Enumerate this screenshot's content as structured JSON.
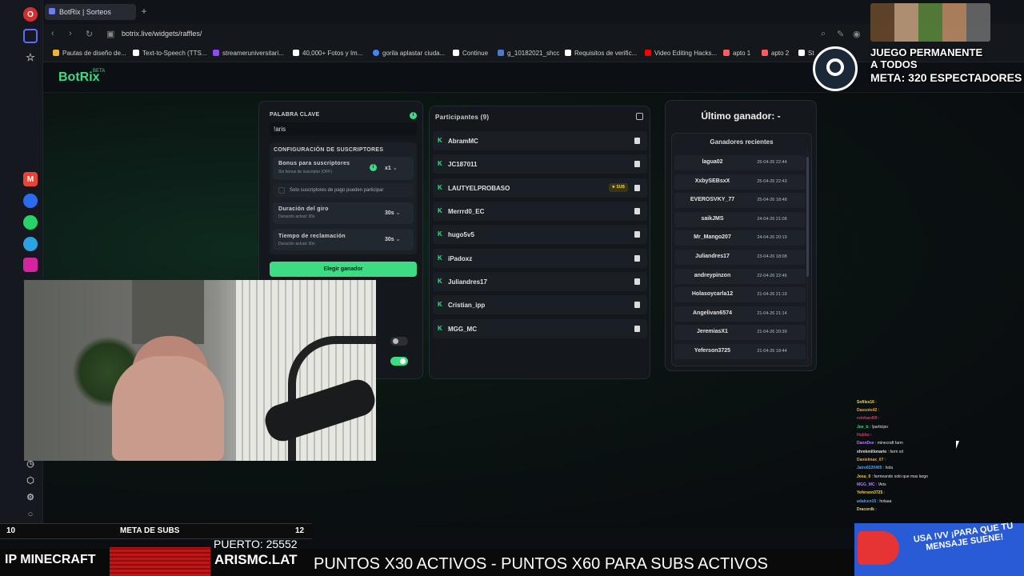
{
  "browser": {
    "tab_title": "BotRix | Sorteos",
    "new_tab": "+",
    "url": "botrix.live/widgets/raffles/",
    "bookmarks": [
      {
        "label": "Pautas de diseño de...",
        "color": "#f2b233"
      },
      {
        "label": "Text-to-Speech (TTS...",
        "color": "#ffffff"
      },
      {
        "label": "streameruniversitari...",
        "color": "#9146ff"
      },
      {
        "label": "40,000+ Fotos y Im...",
        "color": "#ffffff"
      },
      {
        "label": "gorila aplastar ciuda...",
        "color": "#4285f4"
      },
      {
        "label": "Continue",
        "color": "#ffffff"
      },
      {
        "label": "g_10182021_shcc",
        "color": "#4a7bd0"
      },
      {
        "label": "Requisitos de verific...",
        "color": "#ffffff"
      },
      {
        "label": "Video Editing Hacks...",
        "color": "#ff0000"
      },
      {
        "label": "apto 1",
        "color": "#ff5a5f"
      },
      {
        "label": "apto 2",
        "color": "#ff5a5f"
      },
      {
        "label": "St",
        "color": "#ffffff"
      }
    ],
    "rail_icons": [
      "opera-logo-icon",
      "home-icon",
      "star-icon",
      "gmail-icon",
      "messenger-icon",
      "whatsapp-icon",
      "telegram-icon",
      "instagram-icon",
      "clock-icon",
      "cube-icon",
      "settings-icon",
      "bulb-icon"
    ]
  },
  "app": {
    "logo": "BotRix",
    "logo_badge": "BETA",
    "accent": "#3ddc84"
  },
  "settings": {
    "keyword_label": "PALABRA CLAVE",
    "keyword_value": "!aris",
    "subs_section_title": "CONFIGURACIÓN DE SUSCRIPTORES",
    "bonus_title": "Bonus para suscriptores",
    "bonus_sub": "Sin bonus de suscriptor (OFF)",
    "bonus_value": "x1",
    "paid_only_label": "Solo suscriptores de pago pueden participar",
    "spin_title": "Duración del giro",
    "spin_sub": "Duración actual: 30s",
    "spin_value": "30s",
    "claim_title": "Tiempo de reclamación",
    "claim_sub": "Duración actual: 30s",
    "claim_value": "30s",
    "choose_button": "Elegir ganador"
  },
  "participants": {
    "title": "Participantes (9)",
    "items": [
      {
        "name": "AbramMC",
        "badge": ""
      },
      {
        "name": "JC187011",
        "badge": ""
      },
      {
        "name": "LAUTYELPROBASO",
        "badge": "★ SUB"
      },
      {
        "name": "Merrrd0_EC",
        "badge": ""
      },
      {
        "name": "hugo5v5",
        "badge": ""
      },
      {
        "name": "iPadoxz",
        "badge": ""
      },
      {
        "name": "Juliandres17",
        "badge": ""
      },
      {
        "name": "Cristian_ipp",
        "badge": ""
      },
      {
        "name": "MGG_MC",
        "badge": ""
      }
    ]
  },
  "winners": {
    "last_winner": "Último ganador: -",
    "recent_title": "Ganadores recientes",
    "items": [
      {
        "name": "lagua02",
        "date": "25-04-26 22:44"
      },
      {
        "name": "XxbySEBsxX",
        "date": "25-04-26 22:43"
      },
      {
        "name": "EVEROSVKY_77",
        "date": "25-04-26 18:48"
      },
      {
        "name": "saikJMS",
        "date": "24-04-26 21:08"
      },
      {
        "name": "Mr_Mango207",
        "date": "24-04-26 20:19"
      },
      {
        "name": "Juliandres17",
        "date": "23-04-26 18:08"
      },
      {
        "name": "andreypinzon",
        "date": "22-04-26 22:46"
      },
      {
        "name": "Holasoycarla12",
        "date": "21-04-26 21:19"
      },
      {
        "name": "Angelivan6574",
        "date": "21-04-26 21:14"
      },
      {
        "name": "JeremiasX1",
        "date": "21-04-26 20:39"
      },
      {
        "name": "Yeferson3725",
        "date": "21-04-26 18:44"
      }
    ]
  },
  "overlay": {
    "steam_line1": "JUEGO PERMANENTE",
    "steam_line2": "A TODOS",
    "steam_line3": "META: 320 ESPECTADORES",
    "subs_current": "10",
    "subs_title": "META DE SUBS",
    "subs_goal": "12",
    "ip_label": "IP MINECRAFT",
    "aris_logo": "ARIS",
    "port": "PUERTO: 25552",
    "domain": "ARISMC.LAT",
    "marquee": "PUNTOS X30 ACTIVOS - PUNTOS X60 PARA SUBS ACTIVOS",
    "mega_text": "USA !VV ¡PARA QUE TU MENSAJE SUENE!",
    "chat": [
      {
        "user": "Sofiles16",
        "msg": ":",
        "color": "#f2d34a"
      },
      {
        "user": "Dassoto42",
        "msg": ":",
        "color": "#f2a33a"
      },
      {
        "user": "reinhard09",
        "msg": ":",
        "color": "#d23b6a"
      },
      {
        "user": "Joe_b",
        "msg": ": !participo",
        "color": "#3ddc84"
      },
      {
        "user": "Hubbo",
        "msg": ":",
        "color": "#d23b6a"
      },
      {
        "user": "DannDee",
        "msg": ": minecraft farm",
        "color": "#b07cff"
      },
      {
        "user": "shrekmillonario",
        "msg": ": farm xd",
        "color": "#e0e0e0"
      },
      {
        "user": "Danielmax_07",
        "msg": ":",
        "color": "#f2a33a"
      },
      {
        "user": "Jairo6220405",
        "msg": ": hola",
        "color": "#4aa3ff"
      },
      {
        "user": "Josu_0",
        "msg": ": farmeando solo que mas largo",
        "color": "#f2d34a"
      },
      {
        "user": "MGG_MC",
        "msg": ": !Aris",
        "color": "#b07cff"
      },
      {
        "user": "Yeferson3725",
        "msg": ":",
        "color": "#f2d34a"
      },
      {
        "user": "adalcen15",
        "msg": ": holaaa",
        "color": "#4aa3ff"
      },
      {
        "user": "Dracordk",
        "msg": ":",
        "color": "#f2d34a"
      }
    ]
  }
}
